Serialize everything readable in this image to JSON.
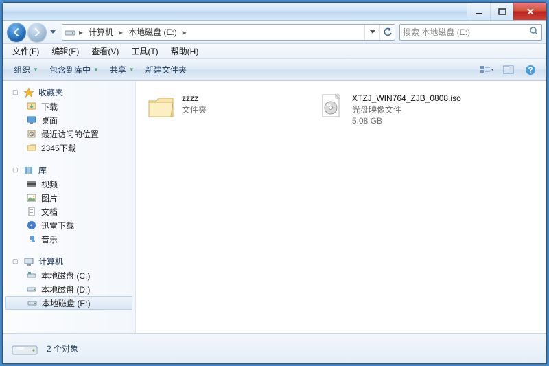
{
  "window": {
    "min_icon": "minimize-icon",
    "max_icon": "maximize-icon",
    "close_icon": "close-icon"
  },
  "nav": {
    "back_icon": "back-arrow-icon",
    "fwd_icon": "forward-arrow-icon",
    "history_icon": "chevron-down-icon"
  },
  "address": {
    "icon": "drive-icon",
    "segments": [
      "计算机",
      "本地磁盘 (E:)"
    ],
    "sep": "▸",
    "refresh_icon": "refresh-icon",
    "drop_icon": "chevron-down-icon"
  },
  "search": {
    "placeholder": "搜索 本地磁盘 (E:)",
    "icon": "search-icon"
  },
  "menu": {
    "items": [
      "文件(F)",
      "编辑(E)",
      "查看(V)",
      "工具(T)",
      "帮助(H)"
    ]
  },
  "toolbar": {
    "organize": "组织",
    "include": "包含到库中",
    "share": "共享",
    "newfolder": "新建文件夹",
    "view_icon": "view-icon",
    "preview_icon": "preview-pane-icon",
    "help_icon": "help-icon"
  },
  "sidebar": {
    "groups": [
      {
        "label": "收藏夹",
        "icon": "star-icon",
        "items": [
          {
            "label": "下载",
            "icon": "download-icon"
          },
          {
            "label": "桌面",
            "icon": "desktop-icon"
          },
          {
            "label": "最近访问的位置",
            "icon": "recent-icon"
          },
          {
            "label": "2345下载",
            "icon": "folder-icon"
          }
        ]
      },
      {
        "label": "库",
        "icon": "library-icon",
        "items": [
          {
            "label": "视频",
            "icon": "video-icon"
          },
          {
            "label": "图片",
            "icon": "picture-icon"
          },
          {
            "label": "文档",
            "icon": "document-icon"
          },
          {
            "label": "迅雷下载",
            "icon": "thunder-icon"
          },
          {
            "label": "音乐",
            "icon": "music-icon"
          }
        ]
      },
      {
        "label": "计算机",
        "icon": "computer-icon",
        "items": [
          {
            "label": "本地磁盘 (C:)",
            "icon": "drive-c-icon"
          },
          {
            "label": "本地磁盘 (D:)",
            "icon": "drive-icon"
          },
          {
            "label": "本地磁盘 (E:)",
            "icon": "drive-icon",
            "selected": true
          }
        ]
      }
    ]
  },
  "files": [
    {
      "name": "zzzz",
      "type": "文件夹",
      "icon": "folder-large-icon"
    },
    {
      "name": "XTZJ_WIN764_ZJB_0808.iso",
      "type": "光盘映像文件",
      "size": "5.08 GB",
      "icon": "iso-icon"
    }
  ],
  "status": {
    "icon": "drive-large-icon",
    "text": "2 个对象"
  }
}
